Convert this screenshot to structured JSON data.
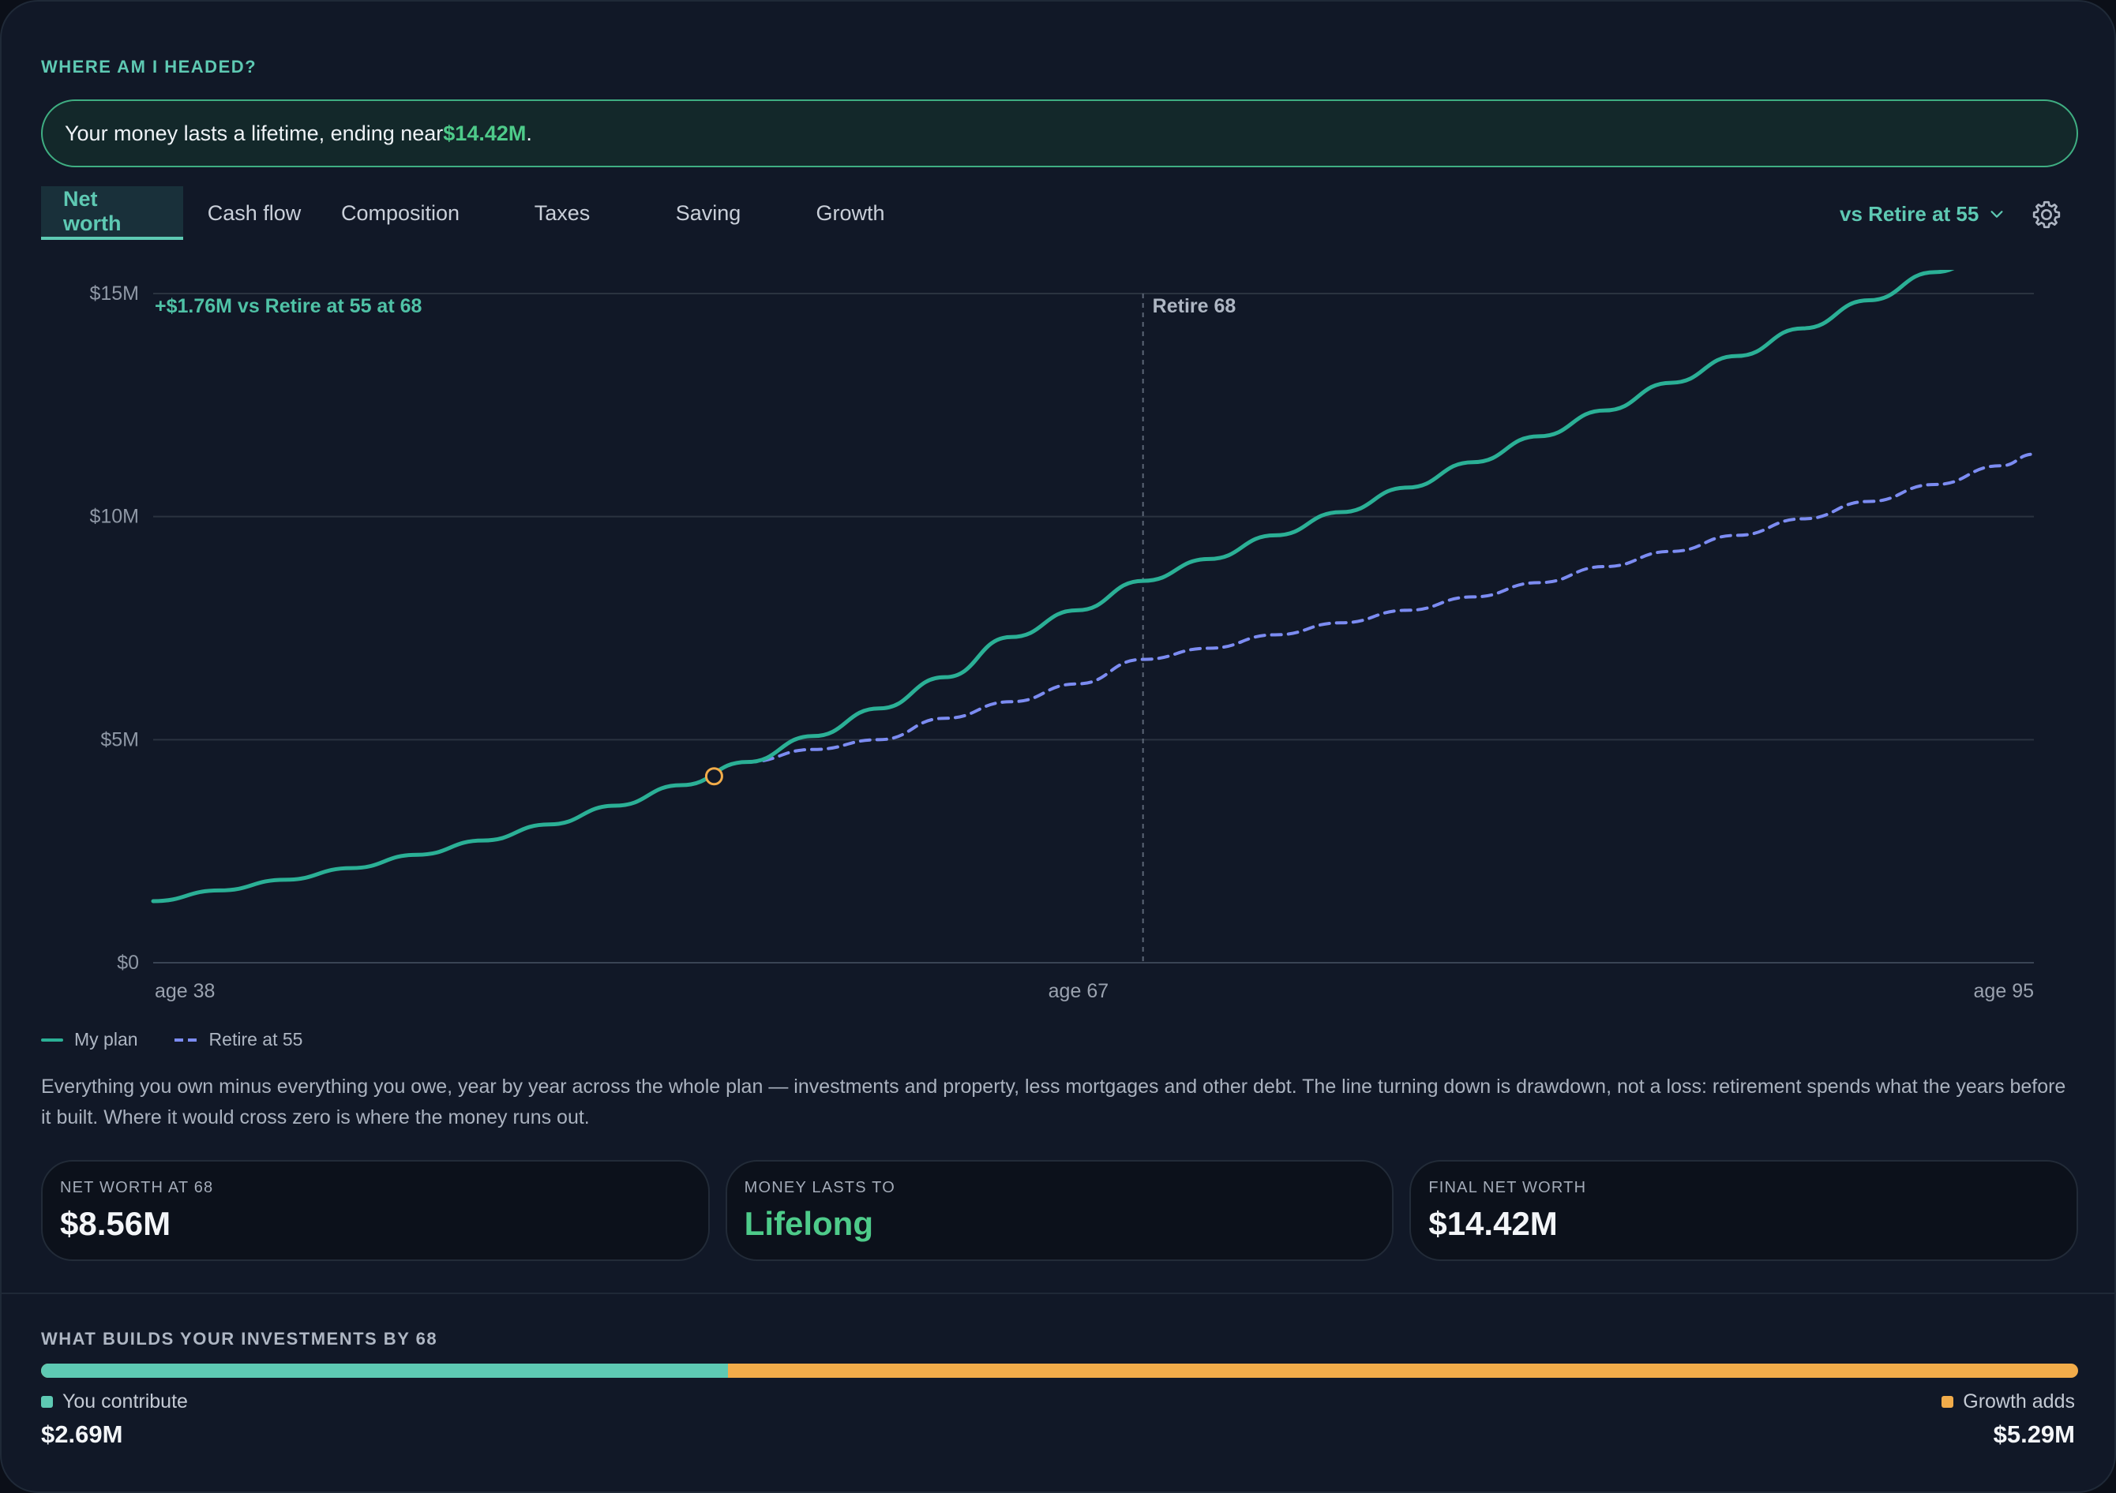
{
  "header": {
    "title": "WHERE AM I HEADED?",
    "banner_prefix": "Your money lasts a lifetime, ending near ",
    "banner_amount": "$14.42M",
    "banner_suffix": "."
  },
  "tabs": [
    {
      "label": "Net worth",
      "active": true
    },
    {
      "label": "Cash flow",
      "active": false
    },
    {
      "label": "Composition",
      "active": false
    },
    {
      "label": "Taxes",
      "active": false
    },
    {
      "label": "Saving",
      "active": false
    },
    {
      "label": "Growth",
      "active": false
    }
  ],
  "compare": {
    "label": "vs Retire at 55",
    "icon": "chevron-down-icon"
  },
  "settings": {
    "icon": "gear-icon"
  },
  "colors": {
    "accent": "#5ec9b3",
    "plan_line": "#2bb096",
    "compare_line": "#7c8cf2",
    "marker": "#f2ac4a",
    "positive": "#4ecb8a",
    "growth": "#f2ac4a"
  },
  "chart_data": {
    "type": "line",
    "x": [
      38,
      40,
      42,
      44,
      46,
      48,
      50,
      52,
      54,
      56,
      58,
      60,
      62,
      64,
      66,
      68,
      70,
      72,
      74,
      76,
      78,
      80,
      82,
      84,
      86,
      88,
      90,
      92,
      94,
      95
    ],
    "series": [
      {
        "name": "My plan",
        "style": "solid",
        "values": [
          1.38,
          1.62,
          1.86,
          2.12,
          2.42,
          2.74,
          3.1,
          3.52,
          3.98,
          4.5,
          5.08,
          5.7,
          6.4,
          7.3,
          7.9,
          8.56,
          9.05,
          9.58,
          10.1,
          10.65,
          11.22,
          11.8,
          12.38,
          13.0,
          13.6,
          14.22,
          14.85,
          15.48,
          16.12,
          16.44
        ]
      },
      {
        "name": "Retire at 55",
        "style": "dashed",
        "values": [
          null,
          null,
          null,
          null,
          null,
          null,
          null,
          null,
          null,
          4.5,
          4.78,
          5.0,
          5.48,
          5.85,
          6.25,
          6.8,
          7.05,
          7.35,
          7.62,
          7.9,
          8.2,
          8.52,
          8.88,
          9.22,
          9.58,
          9.95,
          10.34,
          10.72,
          11.14,
          11.4
        ]
      }
    ],
    "today_marker": {
      "age": 55,
      "value": 4.18
    },
    "vertical_marker": {
      "age": 68,
      "label": "Retire 68"
    },
    "delta_label": "+$1.76M vs Retire at 55 at 68",
    "y_ticks": [
      "$15M",
      "$10M",
      "$5M",
      "$0"
    ],
    "y_tick_values": [
      15,
      10,
      5,
      0
    ],
    "x_tick_labels": [
      "age 38",
      "age 67",
      "age 95"
    ],
    "x_tick_values": [
      38,
      67,
      95
    ],
    "ylim": [
      0,
      15
    ],
    "xlim": [
      38,
      95
    ],
    "grid": true,
    "legend_position": "bottom-left"
  },
  "legend": {
    "plan": "My plan",
    "compare": "Retire at 55"
  },
  "description": "Everything you own minus everything you owe, year by year across the whole plan — investments and property, less mortgages and other debt. The line turning down is drawdown, not a loss: retirement spends what the years before it built. Where it would cross zero is where the money runs out.",
  "stats": [
    {
      "label": "NET WORTH AT 68",
      "value": "$8.56M",
      "tone": "normal"
    },
    {
      "label": "MONEY LASTS TO",
      "value": "Lifelong",
      "tone": "green"
    },
    {
      "label": "FINAL NET WORTH",
      "value": "$14.42M",
      "tone": "normal"
    }
  ],
  "builds": {
    "title": "WHAT BUILDS YOUR INVESTMENTS BY 68",
    "contribute_label": "You contribute",
    "contribute_value": "$2.69M",
    "contribute_amount": 2.69,
    "growth_label": "Growth adds",
    "growth_value": "$5.29M",
    "growth_amount": 5.29
  }
}
